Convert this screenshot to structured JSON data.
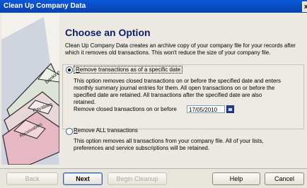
{
  "window": {
    "title": "Clean Up Company Data",
    "close_glyph": "x"
  },
  "illustration": {
    "tab1": "Banking",
    "tab2": "Payables",
    "tab3": "Receivables"
  },
  "heading": "Choose an Option",
  "intro": "Clean Up Company Data creates an archive copy of your company file for your records after which it removes old transactions. This won't reduce the size of your company file.",
  "option1": {
    "label": "Remove transactions as of a specific date",
    "mnemonic": "R",
    "selected": true,
    "desc_lines": [
      "This option removes closed transactions on or before the specified date and enters",
      "monthly summary journal entries for them.  All open transactions on or before the",
      "specified date are retained.  All transactions after the specified date are also",
      "retained."
    ],
    "date_label": "Remove closed transactions on or before",
    "date_value": "17/05/2010"
  },
  "option2": {
    "label": "Remove ALL transactions",
    "mnemonic": "R",
    "selected": false,
    "desc_lines": [
      "This option removes all transactions from your company file.  All of your lists,",
      "preferences and service subscriptions will be retained."
    ]
  },
  "buttons": {
    "back": "Back",
    "next": "Next",
    "begin_cleanup": "Begin Cleanup",
    "help": "Help",
    "cancel": "Cancel"
  }
}
